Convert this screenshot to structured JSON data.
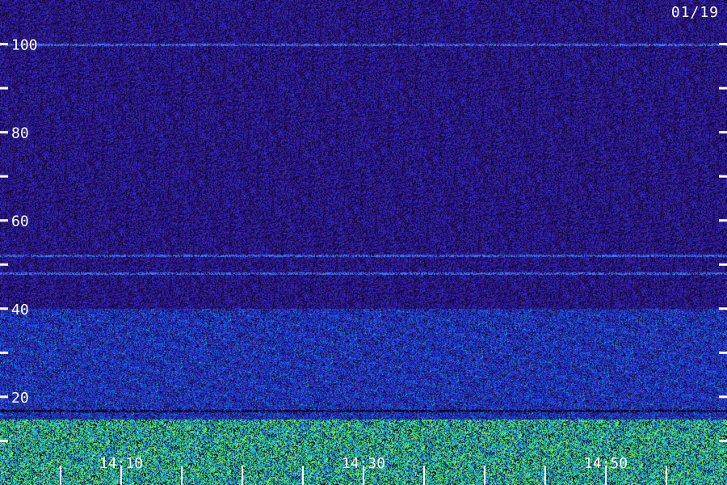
{
  "date_label": "01/19",
  "colors": {
    "background": "#1a0c5e",
    "low_energy": "#2a17b0",
    "high_energy": "#1ad08a",
    "peak": "#9cff3a",
    "axis": "#ffffff"
  },
  "chart_data": {
    "type": "heatmap",
    "title": "",
    "xlabel": "",
    "ylabel": "",
    "ylim": [
      0,
      110
    ],
    "y_ticks": [
      10,
      20,
      30,
      40,
      50,
      60,
      70,
      80,
      90,
      100
    ],
    "y_tick_labels": [
      {
        "value": 20,
        "text": "20"
      },
      {
        "value": 40,
        "text": "40"
      },
      {
        "value": 60,
        "text": "60"
      },
      {
        "value": 80,
        "text": "80"
      },
      {
        "value": 100,
        "text": "100"
      }
    ],
    "x_range_min": [
      0,
      60
    ],
    "x_ticks_min": [
      5,
      10,
      15,
      20,
      25,
      30,
      35,
      40,
      45,
      50,
      55
    ],
    "x_tick_labels": [
      {
        "value": 10,
        "text": "14:10"
      },
      {
        "value": 30,
        "text": "14:30"
      },
      {
        "value": 50,
        "text": "14:50"
      }
    ],
    "intensity_bands": [
      {
        "y_from": 0,
        "y_to": 15,
        "level": "high"
      },
      {
        "y_from": 15,
        "y_to": 40,
        "level": "medium"
      },
      {
        "y_from": 40,
        "y_to": 110,
        "level": "low"
      }
    ],
    "persistent_lines_y": [
      100,
      48,
      52
    ]
  }
}
